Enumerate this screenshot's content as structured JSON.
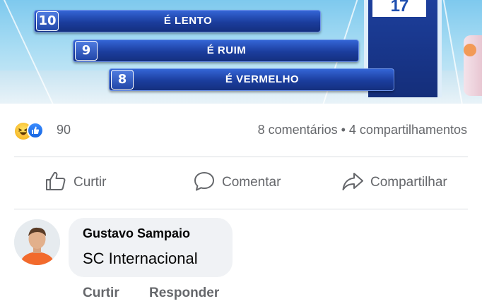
{
  "post_image": {
    "screen_number": "17",
    "ranking": [
      {
        "rank": "10",
        "label": "É LENTO"
      },
      {
        "rank": "9",
        "label": "É RUIM"
      },
      {
        "rank": "8",
        "label": "É VERMELHO"
      }
    ]
  },
  "reactions": {
    "icons": [
      "haha-reaction-icon",
      "like-reaction-icon"
    ],
    "count": "90",
    "stats": "8 comentários • 4 compartilhamentos"
  },
  "actions": {
    "like": {
      "label": "Curtir",
      "icon": "thumbs-up-icon"
    },
    "comment": {
      "label": "Comentar",
      "icon": "speech-bubble-icon"
    },
    "share": {
      "label": "Compartilhar",
      "icon": "share-arrow-icon"
    }
  },
  "comment": {
    "author": "Gustavo Sampaio",
    "text": "SC Internacional",
    "like_label": "Curtir",
    "reply_label": "Responder"
  },
  "colors": {
    "text_secondary": "#65676b",
    "bubble": "#f0f2f5",
    "like_blue": "#1877f2",
    "tv_bar_blue": "#1b3d9d"
  }
}
